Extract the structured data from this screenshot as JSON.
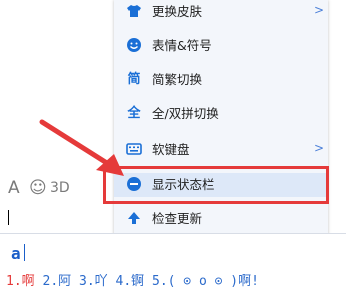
{
  "menu": {
    "items": [
      {
        "icon": "shirt-icon",
        "label": "更换皮肤",
        "has_submenu": true
      },
      {
        "icon": "emoji-icon",
        "label": "表情&符号",
        "has_submenu": false
      },
      {
        "icon": "jian-icon",
        "glyph": "简",
        "label": "简繁切换",
        "has_submenu": false
      },
      {
        "icon": "quan-icon",
        "glyph": "全",
        "label": "全/双拼切换",
        "has_submenu": false
      },
      {
        "icon": "keyboard-icon",
        "label": "软键盘",
        "has_submenu": true
      },
      {
        "icon": "minus-circle-icon",
        "label": "显示状态栏",
        "has_submenu": false
      },
      {
        "icon": "up-arrow-icon",
        "label": "检查更新",
        "has_submenu": false
      }
    ],
    "submenu_arrow": ">"
  },
  "toolbar": {
    "font_glyph": "A",
    "emoji_glyph": "☺",
    "cut_glyph": "3D"
  },
  "ime": {
    "composition": "a",
    "candidates": [
      {
        "index": "1.",
        "text": "啊"
      },
      {
        "index": "2.",
        "text": "阿"
      },
      {
        "index": "3.",
        "text": "吖"
      },
      {
        "index": "4.",
        "text": "锕"
      },
      {
        "index": "5.",
        "text": "( ⊙ o ⊙ )啊!"
      }
    ]
  },
  "colors": {
    "accent": "#1a6fd6",
    "highlight_border": "#e53a3a",
    "candidate_first": "#e53a3a"
  }
}
